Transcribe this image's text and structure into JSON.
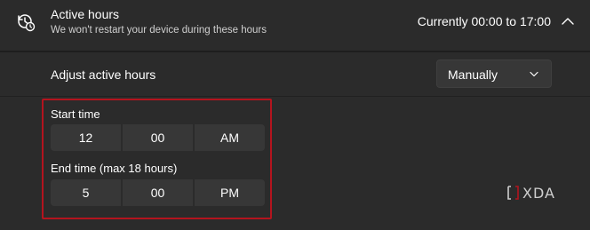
{
  "header": {
    "title": "Active hours",
    "subtitle": "We won't restart your device during these hours",
    "status": "Currently 00:00 to 17:00",
    "icon": "clock-sync-icon"
  },
  "adjust": {
    "label": "Adjust active hours",
    "dropdown_value": "Manually"
  },
  "start_time": {
    "label": "Start time",
    "hour": "12",
    "minute": "00",
    "period": "AM"
  },
  "end_time": {
    "label": "End time (max 18 hours)",
    "hour": "5",
    "minute": "00",
    "period": "PM"
  },
  "watermark": {
    "text": "XDA"
  },
  "colors": {
    "highlight": "#b4141e",
    "panel": "#2b2b2b",
    "control": "#373737"
  }
}
